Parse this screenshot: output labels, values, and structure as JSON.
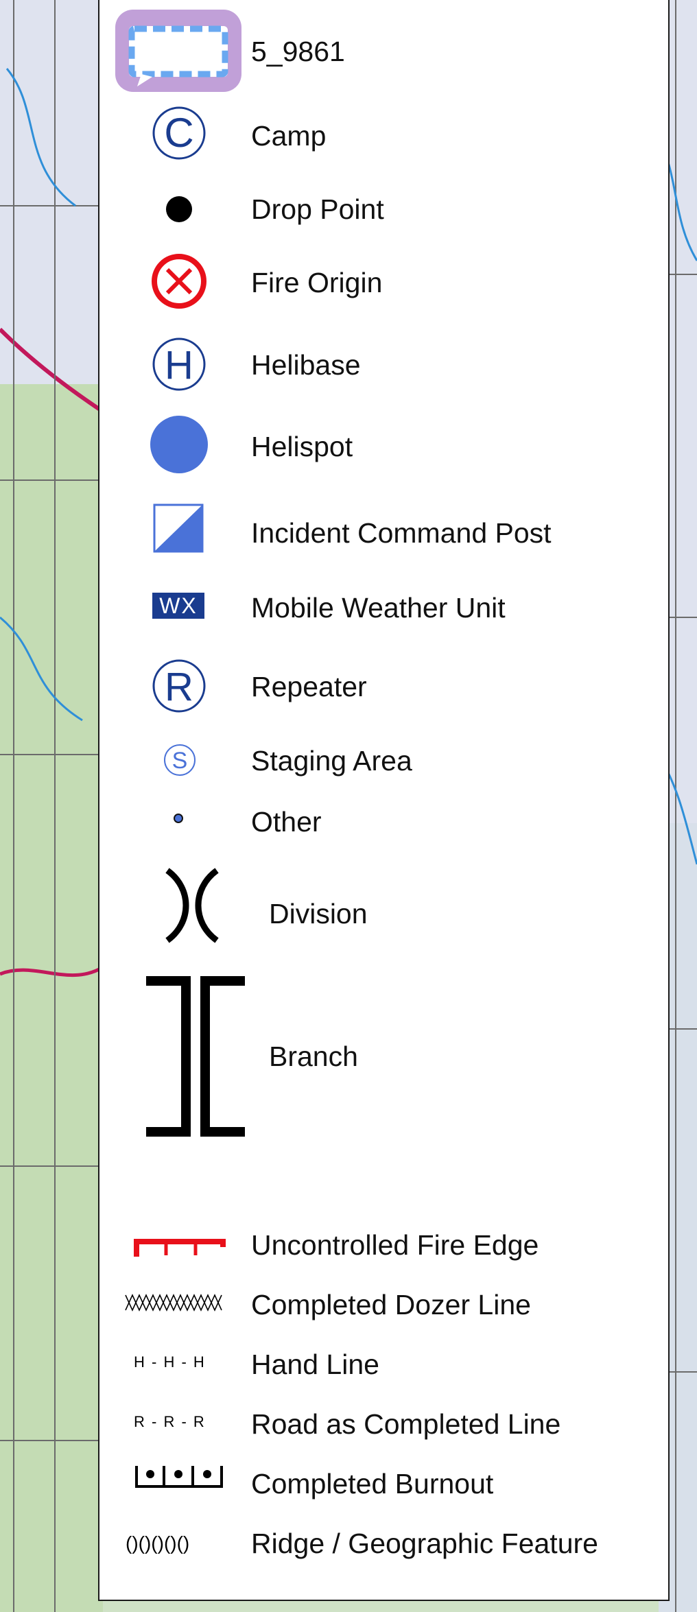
{
  "legend": {
    "title_label": "5_9861",
    "items": [
      {
        "label": "Camp",
        "icon": "camp-c-icon"
      },
      {
        "label": "Drop Point",
        "icon": "drop-point-dot-icon"
      },
      {
        "label": "Fire Origin",
        "icon": "fire-origin-icon"
      },
      {
        "label": "Helibase",
        "icon": "helibase-h-icon"
      },
      {
        "label": "Helispot",
        "icon": "helispot-circle-icon"
      },
      {
        "label": "Incident Command Post",
        "icon": "icp-flag-icon"
      },
      {
        "label": "Mobile Weather Unit",
        "icon": "weather-unit-icon",
        "icon_text": "WX"
      },
      {
        "label": "Repeater",
        "icon": "repeater-r-icon"
      },
      {
        "label": "Staging Area",
        "icon": "staging-s-icon"
      },
      {
        "label": "Other",
        "icon": "other-dot-icon"
      },
      {
        "label": "Division",
        "icon": "division-break-icon"
      },
      {
        "label": "Branch",
        "icon": "branch-break-icon"
      },
      {
        "label": "Uncontrolled Fire Edge",
        "icon": "uncontrolled-edge-icon"
      },
      {
        "label": "Completed Dozer Line",
        "icon": "dozer-line-icon"
      },
      {
        "label": "Hand Line",
        "icon": "hand-line-icon",
        "icon_text": "H - H - H"
      },
      {
        "label": "Road as Completed Line",
        "icon": "road-line-icon",
        "icon_text": "R - R - R"
      },
      {
        "label": "Completed Burnout",
        "icon": "burnout-line-icon"
      },
      {
        "label": "Ridge / Geographic Feature",
        "icon": "ridge-line-icon",
        "icon_text": "()()()()()"
      }
    ]
  },
  "colors": {
    "blue_dark": "#1a3c8f",
    "blue_fill": "#4a72d8",
    "red": "#e8101a",
    "highlight_purple": "#c1a0d8",
    "highlight_dash": "#6aa8f0"
  }
}
